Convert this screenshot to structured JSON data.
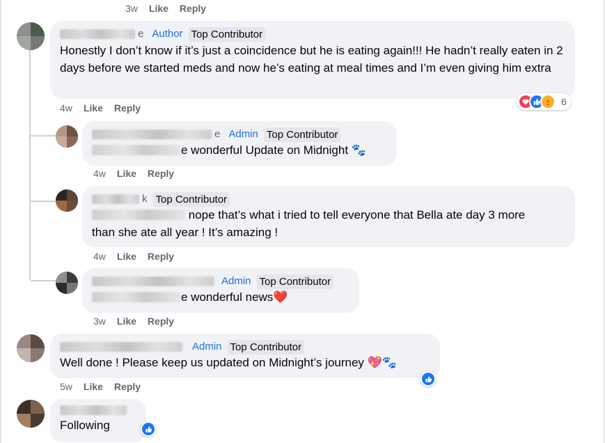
{
  "top_meta": {
    "time": "3w",
    "like": "Like",
    "reply": "Reply"
  },
  "comments": [
    {
      "name_tail": "e",
      "role": "Author",
      "badge": "Top Contributor",
      "text": "Honestly I don’t know if it’s just a coincidence but he is eating again!!! He hadn’t really eaten in 2 days before we started meds and now he’s eating at meal times and I’m even giving him extra",
      "time": "4w",
      "like": "Like",
      "reply": "Reply",
      "reaction_count": "6",
      "reaction_icons": [
        "heart-icon",
        "like-icon",
        "care-icon"
      ]
    },
    {
      "name_tail": "e",
      "role": "Admin",
      "badge": "Top Contributor",
      "text": "e wonderful Update on Midnight 🐾",
      "time": "4w",
      "like": "Like",
      "reply": "Reply"
    },
    {
      "name_tail": "k",
      "role": "",
      "badge": "Top Contributor",
      "text": "nope that’s what i tried to tell everyone that Bella ate day 3 more",
      "text_line2": "than she ate all year ! It’s amazing !",
      "time": "4w",
      "like": "Like",
      "reply": "Reply"
    },
    {
      "name_tail": "",
      "role": "Admin",
      "badge": "Top Contributor",
      "text": "e wonderful news❤️",
      "time": "3w",
      "like": "Like",
      "reply": "Reply"
    },
    {
      "name_tail": "",
      "role": "Admin",
      "badge": "Top Contributor",
      "text": "Well done ! Please keep us updated on Midnight’s journey 💖🐾",
      "time": "5w",
      "like": "Like",
      "reply": "Reply",
      "reaction_icons": [
        "like-icon"
      ]
    },
    {
      "name_tail": "",
      "role": "",
      "badge": "",
      "text": "Following",
      "reaction_icons": [
        "like-icon"
      ]
    }
  ],
  "colors": {
    "bubble": "#f0f2f5",
    "role": "#216fdb",
    "meta": "#65676b",
    "like_blue": "#1877f2",
    "heart_red": "#f33e58"
  }
}
